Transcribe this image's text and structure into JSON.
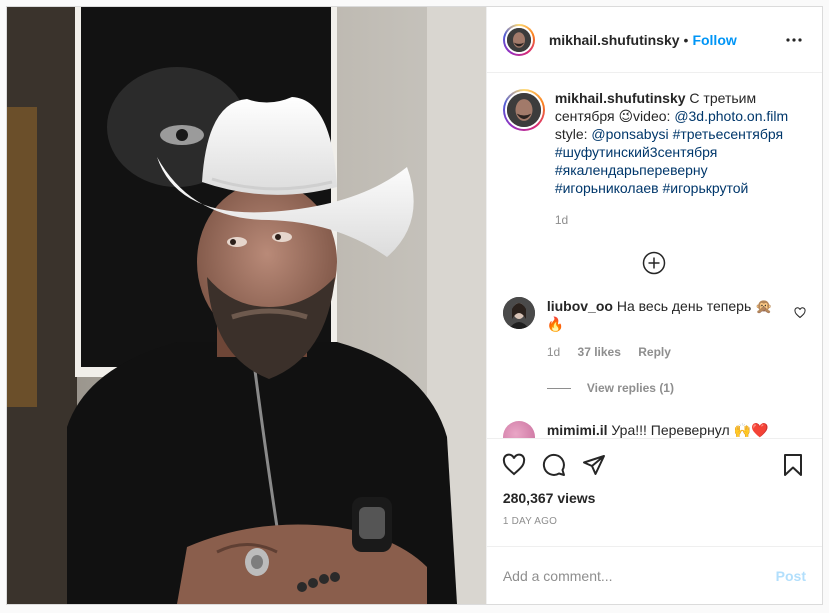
{
  "post": {
    "username": "mikhail.shufutinsky",
    "dot": "•",
    "follow_label": "Follow",
    "more_icon": "more-horizontal-icon"
  },
  "caption": {
    "username": "mikhail.shufutinsky",
    "text_start": "С третьим сентября 😉video:",
    "video_handle": "@3d.photo.on.film",
    "style_label": "style:",
    "style_handle": "@ponsabysi",
    "tags": [
      "#третьесентября",
      "#шуфутинский3сентября",
      "#якалендарьпереверну",
      "#игорьниколаев",
      "#игорькрутой"
    ],
    "age": "1d"
  },
  "load_more_icon": "plus-circle-icon",
  "comments": [
    {
      "username": "liubov_oo",
      "text": "На весь день теперь 🙊🔥",
      "age": "1d",
      "likes": "37 likes",
      "reply": "Reply",
      "view_replies": "View replies (1)"
    },
    {
      "username": "mimimi.il",
      "text": "Ура!!! Перевернул 🙌❤️"
    }
  ],
  "actions": {
    "like_icon": "heart-icon",
    "comment_icon": "comment-icon",
    "share_icon": "paper-plane-icon",
    "save_icon": "bookmark-icon"
  },
  "stats": {
    "views": "280,367 views",
    "date": "1 DAY AGO"
  },
  "add_comment": {
    "placeholder": "Add a comment...",
    "post_label": "Post"
  },
  "colors": {
    "accent": "#0095f6",
    "link": "#00376b",
    "muted": "#8e8e8e",
    "post_disabled": "#b2dffc"
  }
}
